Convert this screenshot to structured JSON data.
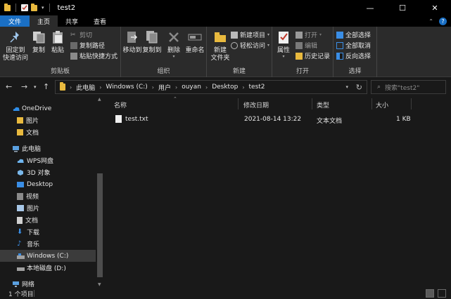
{
  "window": {
    "title": "test2",
    "minimize": "—",
    "maximize": "☐",
    "close": "✕"
  },
  "ribbon_tabs": [
    "文件",
    "主页",
    "共享",
    "查看"
  ],
  "ribbon": {
    "clipboard": {
      "label": "剪贴板",
      "pin": [
        "固定到",
        "快速访问"
      ],
      "copy": "复制",
      "paste": "粘贴",
      "cut": "剪切",
      "copy_path": "复制路径",
      "paste_shortcut": "粘贴快捷方式"
    },
    "organize": {
      "label": "组织",
      "move_to": "移动到",
      "copy_to": "复制到",
      "delete": "删除",
      "rename": "重命名"
    },
    "new": {
      "label": "新建",
      "new_folder": [
        "新建",
        "文件夹"
      ],
      "new_item": "新建项目",
      "easy_access": "轻松访问"
    },
    "open": {
      "label": "打开",
      "properties": "属性",
      "open": "打开",
      "edit": "编辑",
      "history": "历史记录"
    },
    "select": {
      "label": "选择",
      "select_all": "全部选择",
      "select_none": "全部取消",
      "invert": "反向选择"
    }
  },
  "address": {
    "crumbs": [
      "此电脑",
      "Windows (C:)",
      "用户",
      "ouyan",
      "Desktop",
      "test2"
    ],
    "search_placeholder": "搜索\"test2\""
  },
  "nav_pane": {
    "items": [
      {
        "label": "OneDrive",
        "icon": "cloud-icon"
      },
      {
        "label": "图片",
        "icon": "folder-icon"
      },
      {
        "label": "文档",
        "icon": "folder-icon"
      },
      {
        "label": "此电脑",
        "icon": "computer-icon"
      },
      {
        "label": "WPS网盘",
        "icon": "cloud-drive-icon"
      },
      {
        "label": "3D 对象",
        "icon": "cube-icon"
      },
      {
        "label": "Desktop",
        "icon": "desktop-icon"
      },
      {
        "label": "视频",
        "icon": "video-icon"
      },
      {
        "label": "图片",
        "icon": "pictures-icon"
      },
      {
        "label": "文档",
        "icon": "documents-icon"
      },
      {
        "label": "下载",
        "icon": "download-icon"
      },
      {
        "label": "音乐",
        "icon": "music-icon"
      },
      {
        "label": "Windows (C:)",
        "icon": "drive-icon"
      },
      {
        "label": "本地磁盘 (D:)",
        "icon": "drive-icon"
      },
      {
        "label": "网络",
        "icon": "network-icon"
      }
    ]
  },
  "columns": [
    "名称",
    "修改日期",
    "类型",
    "大小"
  ],
  "files": [
    {
      "name": "test.txt",
      "modified": "2021-08-14 13:22",
      "type": "文本文档",
      "size": "1 KB"
    }
  ],
  "status": {
    "count": "1 个项目"
  },
  "colors": {
    "accent": "#1a6fc4",
    "folder": "#e8b93e",
    "background": "#191919"
  }
}
